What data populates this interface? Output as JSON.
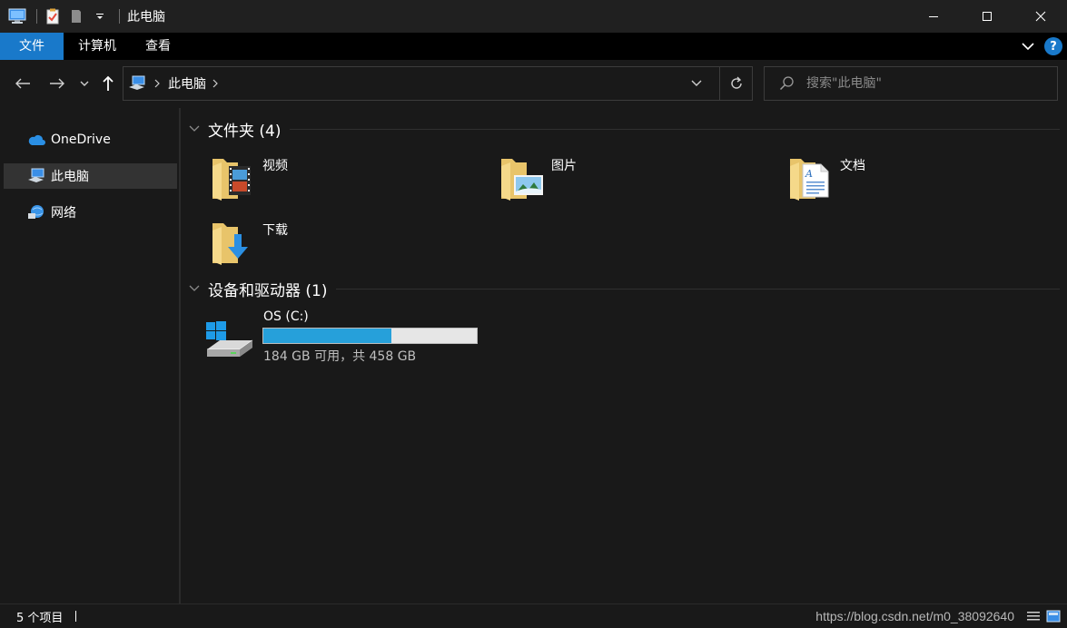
{
  "window": {
    "title": "此电脑",
    "quick_access": [
      "computer-icon",
      "properties-icon",
      "new-folder-icon",
      "customize-dropdown-icon"
    ]
  },
  "ribbon": {
    "tabs": [
      {
        "label": "文件",
        "active": true
      },
      {
        "label": "计算机",
        "active": false
      },
      {
        "label": "查看",
        "active": false
      }
    ],
    "accent": "#1979ca"
  },
  "nav": {
    "breadcrumb": "此电脑",
    "search_placeholder": "搜索\"此电脑\""
  },
  "sidebar": {
    "items": [
      {
        "label": "OneDrive",
        "icon": "onedrive-icon",
        "selected": false
      },
      {
        "label": "此电脑",
        "icon": "this-pc-icon",
        "selected": true
      },
      {
        "label": "网络",
        "icon": "network-icon",
        "selected": false
      }
    ]
  },
  "main": {
    "folders_header": "文件夹 (4)",
    "folders": [
      {
        "label": "视频",
        "icon": "videos-folder-icon"
      },
      {
        "label": "图片",
        "icon": "pictures-folder-icon"
      },
      {
        "label": "文档",
        "icon": "documents-folder-icon"
      },
      {
        "label": "下载",
        "icon": "downloads-folder-icon"
      }
    ],
    "drives_header": "设备和驱动器 (1)",
    "drives": [
      {
        "label": "OS (C:)",
        "icon": "windows-drive-icon",
        "info": "184 GB 可用，共 458 GB",
        "used_fraction": 0.598,
        "bar_color": "#26a0da"
      }
    ]
  },
  "status": {
    "item_count": "5 个项目",
    "watermark": "https://blog.csdn.net/m0_38092640"
  }
}
